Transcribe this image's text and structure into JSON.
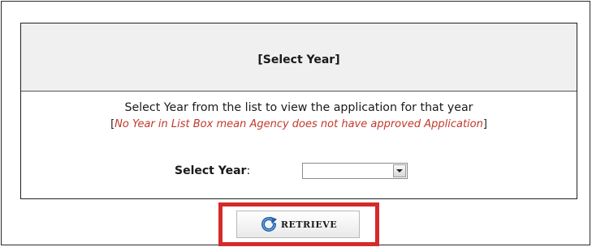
{
  "panel": {
    "title": "[Select Year]",
    "instruction": "Select Year from the list to view the application for that year",
    "note_open": "[",
    "note_text": "No Year in List Box mean Agency does not have approved Application",
    "note_close": "]"
  },
  "year_select": {
    "label": "Select Year",
    "label_suffix": ":",
    "selected_value": "",
    "arrow_icon": "chevron-down-icon"
  },
  "retrieve": {
    "label": "RETRIEVE",
    "icon": "refresh-arrow-icon",
    "highlight_color": "#d42a2a",
    "icon_color": "#1f5fa8"
  },
  "colors": {
    "note_text": "#c0392b",
    "header_bg": "#f0f0f0"
  }
}
